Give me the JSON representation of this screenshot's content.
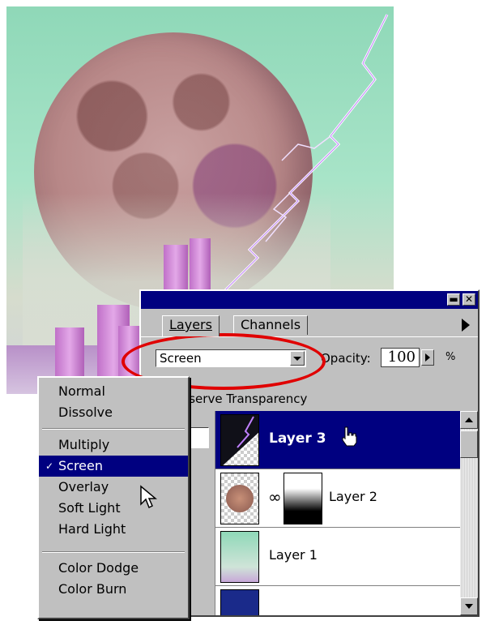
{
  "palette": {
    "tabs": [
      "Layers",
      "Channels"
    ],
    "blend_mode": "Screen",
    "opacity_label": "Opacity:",
    "opacity_value": "100",
    "opacity_unit": "%",
    "preserve_label": "eserve Transparency",
    "layers": [
      {
        "name": "Layer 3",
        "selected": true
      },
      {
        "name": "Layer 2",
        "selected": false
      },
      {
        "name": "Layer 1",
        "selected": false
      }
    ]
  },
  "blend_menu": {
    "groups": [
      [
        "Normal",
        "Dissolve"
      ],
      [
        "Multiply",
        "Screen",
        "Overlay",
        "Soft Light",
        "Hard Light"
      ],
      [
        "Color Dodge",
        "Color Burn"
      ]
    ],
    "selected": "Screen",
    "check_glyph": "✓"
  },
  "colors": {
    "title_bar": "#000080",
    "selection": "#000080",
    "highlight_ellipse": "#e00000",
    "chrome": "#c0c0c0"
  },
  "icons": [
    "minimize-icon",
    "close-icon",
    "palette-menu-arrow-icon",
    "dropdown-arrow-icon",
    "brush-icon",
    "link-icon",
    "hand-cursor-icon",
    "arrow-cursor-icon"
  ]
}
